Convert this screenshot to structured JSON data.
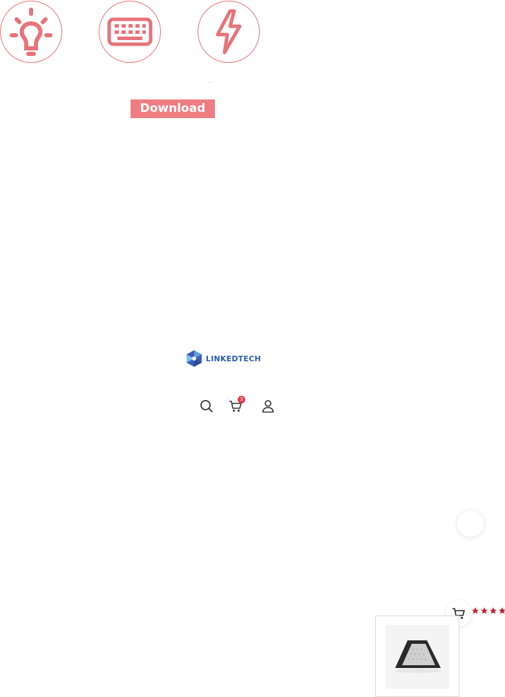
{
  "features": [
    {
      "icon": "lightbulb-icon"
    },
    {
      "icon": "keyboard-icon"
    },
    {
      "icon": "lightning-icon"
    }
  ],
  "feature_caption": "..",
  "download": {
    "label": "Download"
  },
  "logo": {
    "text": "LINKEDTECH"
  },
  "header": {
    "cart_count": "3"
  },
  "product": {
    "rating": 4
  },
  "colors": {
    "accent": "#ef7c80",
    "brand": "#2b5cad",
    "star": "#c0242f",
    "badge": "#e23b4a"
  }
}
